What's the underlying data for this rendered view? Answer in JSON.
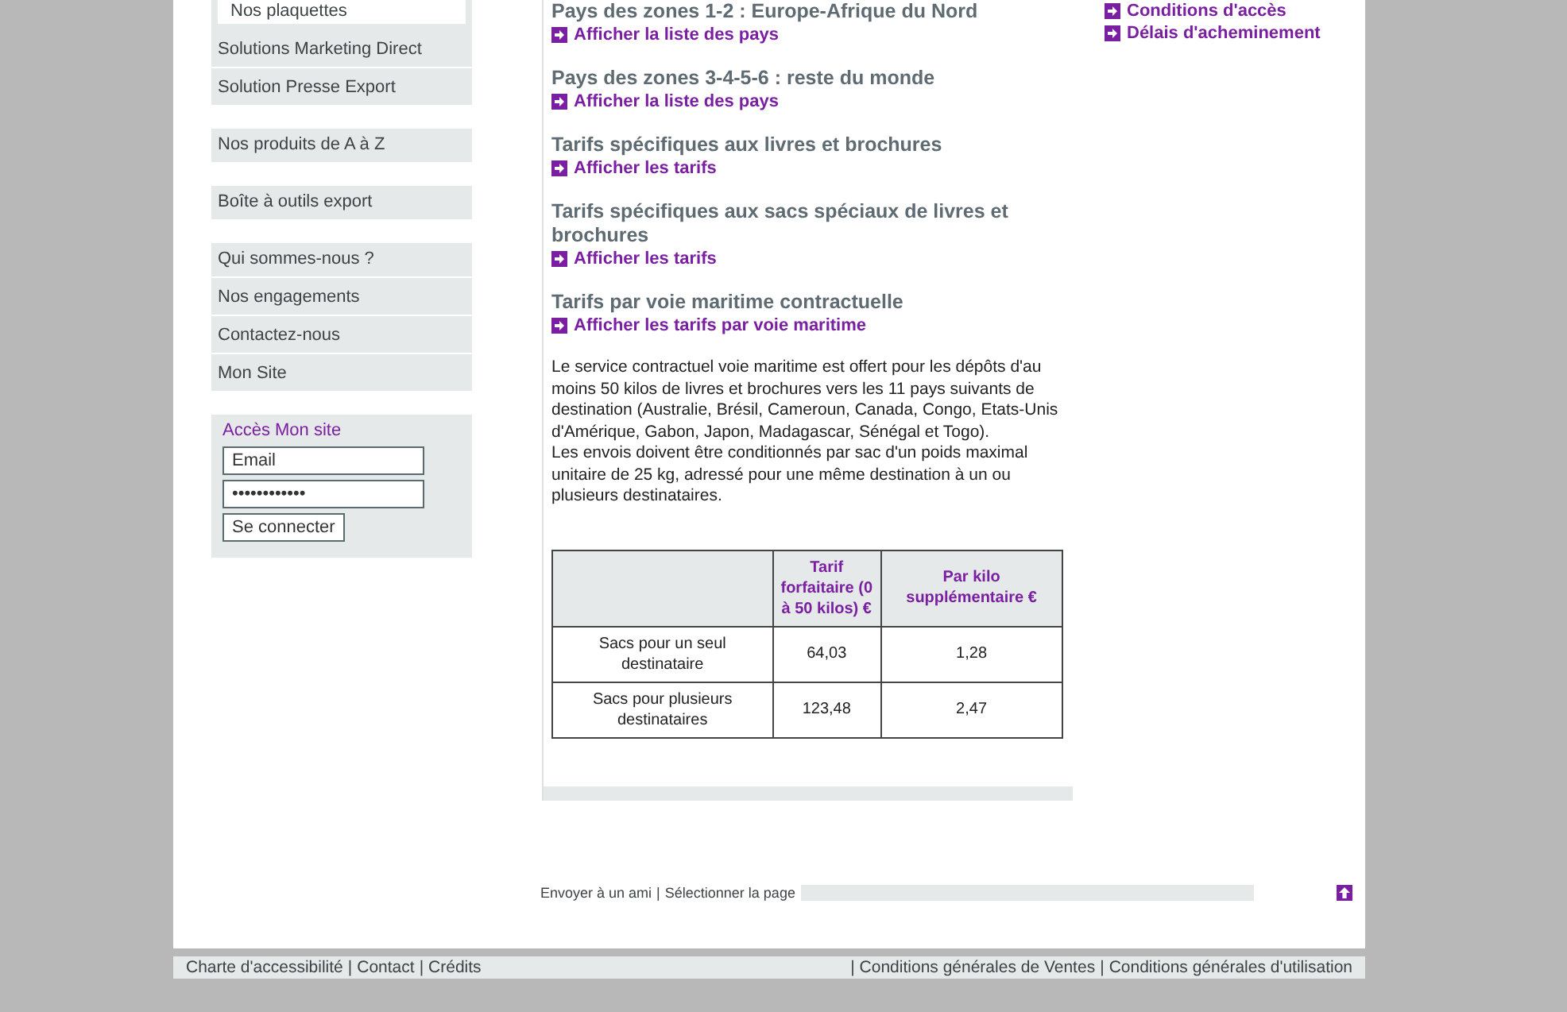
{
  "sidebar": {
    "groups": [
      {
        "items": [
          {
            "label": "Nos plaquettes",
            "kind": "sub"
          },
          {
            "label": "Solutions Marketing Direct",
            "kind": "item"
          },
          {
            "label": "Solution Presse Export",
            "kind": "item"
          }
        ]
      },
      {
        "items": [
          {
            "label": "Nos produits de A à Z",
            "kind": "item"
          }
        ]
      },
      {
        "items": [
          {
            "label": "Boîte à outils export",
            "kind": "item"
          }
        ]
      },
      {
        "items": [
          {
            "label": "Qui sommes-nous ?",
            "kind": "item"
          },
          {
            "label": "Nos engagements",
            "kind": "item"
          },
          {
            "label": "Contactez-nous",
            "kind": "item"
          },
          {
            "label": "Mon Site",
            "kind": "item"
          }
        ]
      }
    ],
    "login": {
      "title": "Accès Mon site",
      "email": "Email",
      "password": "••••••••••••",
      "button": "Se connecter"
    }
  },
  "sections": [
    {
      "heading": "Pays des zones 1-2 : Europe-Afrique du Nord",
      "link": "Afficher la liste des pays"
    },
    {
      "heading": "Pays des zones 3-4-5-6 : reste du monde",
      "link": "Afficher la liste des pays"
    },
    {
      "heading": "Tarifs spécifiques aux livres et brochures",
      "link": "Afficher les tarifs"
    },
    {
      "heading": "Tarifs spécifiques aux sacs spéciaux de livres et brochures",
      "link": "Afficher les tarifs"
    },
    {
      "heading": "Tarifs par voie maritime contractuelle",
      "link": "Afficher les tarifs par voie maritime"
    }
  ],
  "paragraphs": [
    "Le service contractuel voie maritime est offert pour les dépôts d'au moins 50 kilos de livres et brochures vers les 11 pays suivants de destination (Australie, Brésil, Cameroun, Canada, Congo, Etats-Unis d'Amérique, Gabon, Japon, Madagascar, Sénégal et Togo).",
    "Les envois doivent être conditionnés par sac d'un poids maximal unitaire de 25 kg, adressé pour une même destination à un ou plusieurs destinataires."
  ],
  "table": {
    "columns": [
      "",
      "Tarif forfaitaire (0 à 50 kilos) €",
      "Par kilo supplémentaire €"
    ],
    "rows": [
      [
        "Sacs pour un seul destinataire",
        "64,03",
        "1,28"
      ],
      [
        "Sacs pour plusieurs destinataires",
        "123,48",
        "2,47"
      ]
    ]
  },
  "right_links": [
    "Conditions d'accès",
    "Délais d'acheminement"
  ],
  "page_tools": [
    "Envoyer à un ami",
    "|",
    "Sélectionner la page"
  ],
  "footer_left": [
    "Charte d'accessibilité",
    "|",
    "Contact",
    "|",
    "Crédits"
  ],
  "footer_right": [
    "|",
    "Conditions générales de Ventes",
    "|",
    "Conditions générales d'utilisation"
  ]
}
